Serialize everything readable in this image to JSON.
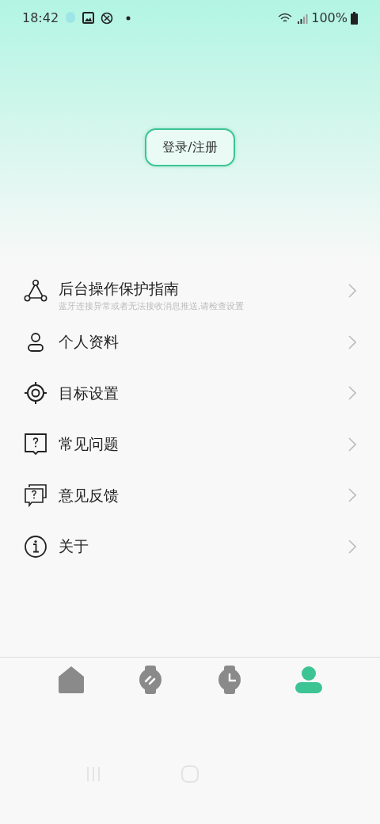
{
  "status_bar": {
    "time": "18:42",
    "battery": "100%"
  },
  "login_button": {
    "label": "登录/注册"
  },
  "menu": [
    {
      "title": "后台操作保护指南",
      "subtitle": "蓝牙连接异常或者无法接收消息推送,请检查设置"
    },
    {
      "title": "个人资料"
    },
    {
      "title": "目标设置"
    },
    {
      "title": "常见问题"
    },
    {
      "title": "意见反馈"
    },
    {
      "title": "关于"
    }
  ],
  "bottom_nav": [
    {
      "selected": false
    },
    {
      "selected": false
    },
    {
      "selected": false
    },
    {
      "selected": true
    }
  ]
}
